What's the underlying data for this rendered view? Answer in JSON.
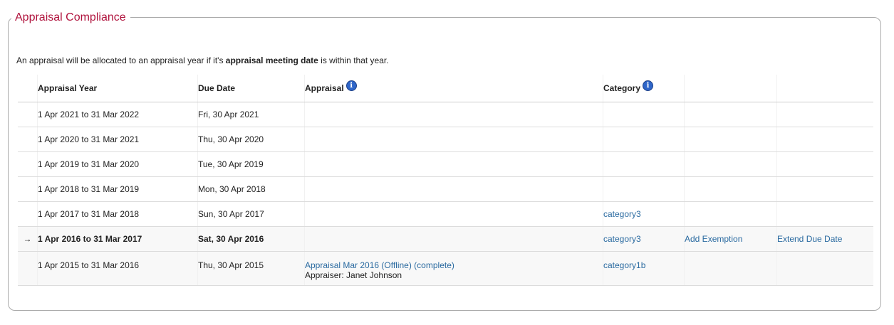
{
  "section": {
    "title": "Appraisal Compliance"
  },
  "intro": {
    "before": "An appraisal will be allocated to an appraisal year if it's ",
    "bold": "appraisal meeting date",
    "after": " is within that year."
  },
  "table": {
    "headers": {
      "year": "Appraisal Year",
      "due": "Due Date",
      "appraisal": "Appraisal",
      "category": "Category"
    },
    "current_marker": "→",
    "rows": [
      {
        "year": "1 Apr 2021 to 31 Mar 2022",
        "due": "Fri, 30 Apr 2021",
        "appraisal": "",
        "appraiser": "",
        "category": "",
        "exemption": "",
        "extend": ""
      },
      {
        "year": "1 Apr 2020 to 31 Mar 2021",
        "due": "Thu, 30 Apr 2020",
        "appraisal": "",
        "appraiser": "",
        "category": "",
        "exemption": "",
        "extend": ""
      },
      {
        "year": "1 Apr 2019 to 31 Mar 2020",
        "due": "Tue, 30 Apr 2019",
        "appraisal": "",
        "appraiser": "",
        "category": "",
        "exemption": "",
        "extend": ""
      },
      {
        "year": "1 Apr 2018 to 31 Mar 2019",
        "due": "Mon, 30 Apr 2018",
        "appraisal": "",
        "appraiser": "",
        "category": "",
        "exemption": "",
        "extend": ""
      },
      {
        "year": "1 Apr 2017 to 31 Mar 2018",
        "due": "Sun, 30 Apr 2017",
        "appraisal": "",
        "appraiser": "",
        "category": "category3",
        "exemption": "",
        "extend": ""
      },
      {
        "year": "1 Apr 2016 to 31 Mar 2017",
        "due": "Sat, 30 Apr 2016",
        "appraisal": "",
        "appraiser": "",
        "category": "category3",
        "exemption": "Add Exemption",
        "extend": "Extend Due Date"
      },
      {
        "year": "1 Apr 2015 to 31 Mar 2016",
        "due": "Thu, 30 Apr 2015",
        "appraisal": "Appraisal Mar 2016 (Offline) (complete)",
        "appraiser": "Appraiser: Janet Johnson",
        "category": "category1b",
        "exemption": "",
        "extend": ""
      }
    ]
  },
  "icons": {
    "info": "info-icon"
  },
  "colors": {
    "title": "#b0133d",
    "link": "#2a6aa0",
    "info_icon": "#2f66c9"
  }
}
